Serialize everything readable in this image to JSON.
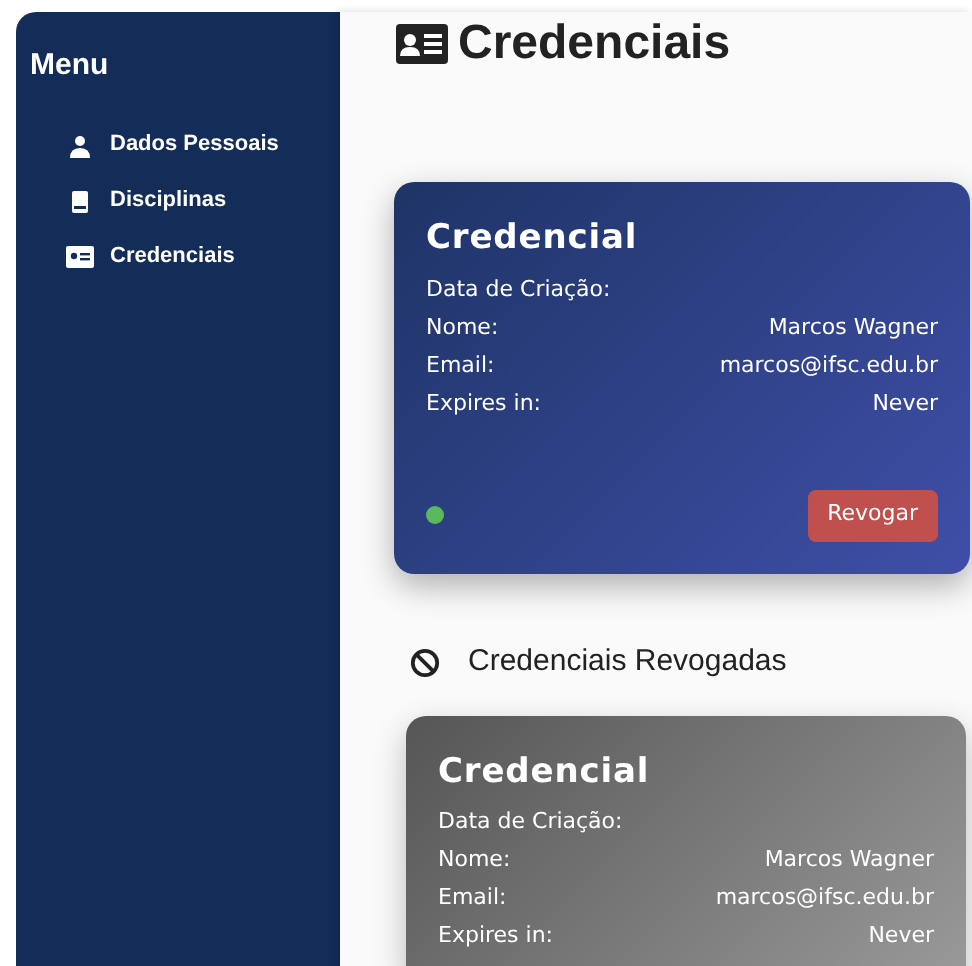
{
  "sidebar": {
    "title": "Menu",
    "items": [
      {
        "label": "Dados Pessoais"
      },
      {
        "label": "Disciplinas"
      },
      {
        "label": "Credenciais"
      }
    ]
  },
  "page": {
    "title": "Credenciais"
  },
  "active_credentials": [
    {
      "kind": "active",
      "title": "Credencial",
      "rows": [
        {
          "label": "Data de Criação:"
        },
        {
          "label": "Nome:",
          "value": "Marcos Wagner"
        },
        {
          "label": "Email:",
          "value": "marcos@ifsc.edu.br"
        },
        {
          "label": "Expires in:",
          "value": "Never"
        }
      ],
      "button": "Revogar"
    }
  ],
  "revoked_section": {
    "title": "Credenciais Revogadas"
  },
  "revoked_credentials": [
    {
      "kind": "revoked",
      "title": "Credencial",
      "rows": [
        {
          "label": "Data de Criação:"
        },
        {
          "label": "Nome:",
          "value": "Marcos Wagner"
        },
        {
          "label": "Email:",
          "value": "marcos@ifsc.edu.br"
        },
        {
          "label": "Expires in:",
          "value": "Never"
        }
      ]
    }
  ]
}
